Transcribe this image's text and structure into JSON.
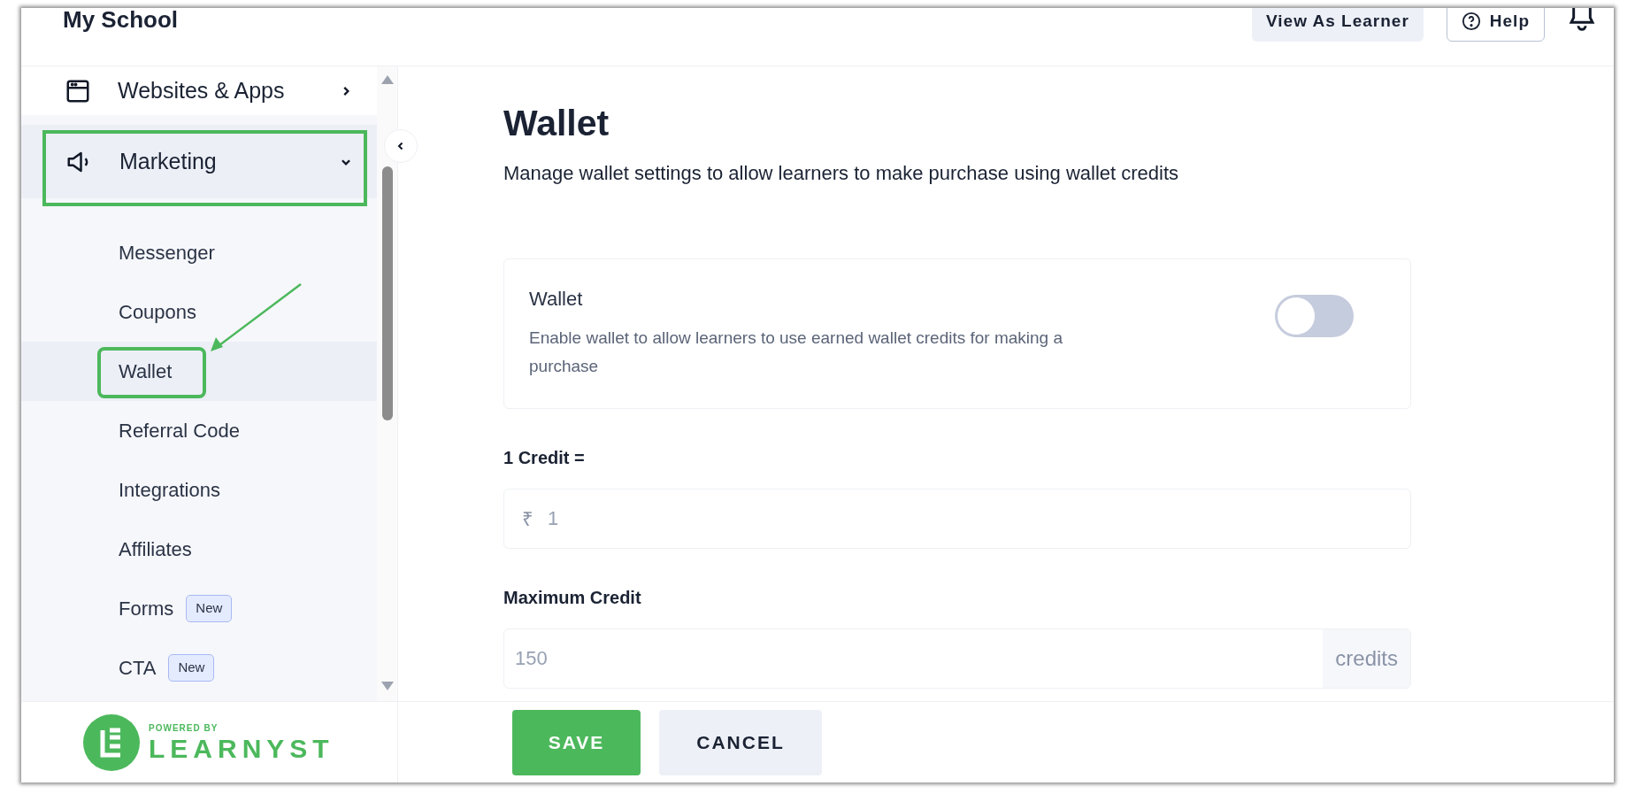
{
  "header": {
    "school_name": "My School",
    "buttons": [
      {
        "label": "View As Learner",
        "kind": "filled"
      },
      {
        "label": "Help",
        "kind": "outlined"
      }
    ]
  },
  "sidebar": {
    "items": [
      {
        "label": "Websites & Apps",
        "kind": "browser",
        "expanded": false,
        "selected": false
      },
      {
        "label": "Marketing",
        "kind": "megaphone",
        "expanded": true,
        "selected": true,
        "children": [
          {
            "label": "Messenger",
            "selected": false
          },
          {
            "label": "Coupons",
            "selected": false
          },
          {
            "label": "Wallet",
            "selected": true
          },
          {
            "label": "Referral Code",
            "selected": false
          },
          {
            "label": "Integrations",
            "selected": false
          },
          {
            "label": "Affiliates",
            "selected": false
          },
          {
            "label": "Forms",
            "badge": "New",
            "selected": false
          },
          {
            "label": "CTA",
            "badge": "New",
            "selected": false
          }
        ]
      }
    ],
    "footer": {
      "powered_by": "POWERED BY",
      "brand": "LEARNYST"
    }
  },
  "page": {
    "title": "Wallet",
    "subtitle": "Manage wallet settings to allow learners to make purchase using wallet credits",
    "wallet_setting": {
      "title": "Wallet",
      "description": "Enable wallet to allow learners to use earned wallet credits for making a purchase",
      "on": false
    },
    "fields": [
      {
        "label": "1 Credit =",
        "prefix": "₹",
        "placeholder": "1"
      },
      {
        "label": "Maximum Credit",
        "placeholder": "150",
        "suffix": "credits"
      }
    ],
    "buttons": [
      {
        "label": "SAVE",
        "kind": "primary"
      },
      {
        "label": "CANCEL",
        "kind": "secondary"
      }
    ]
  }
}
